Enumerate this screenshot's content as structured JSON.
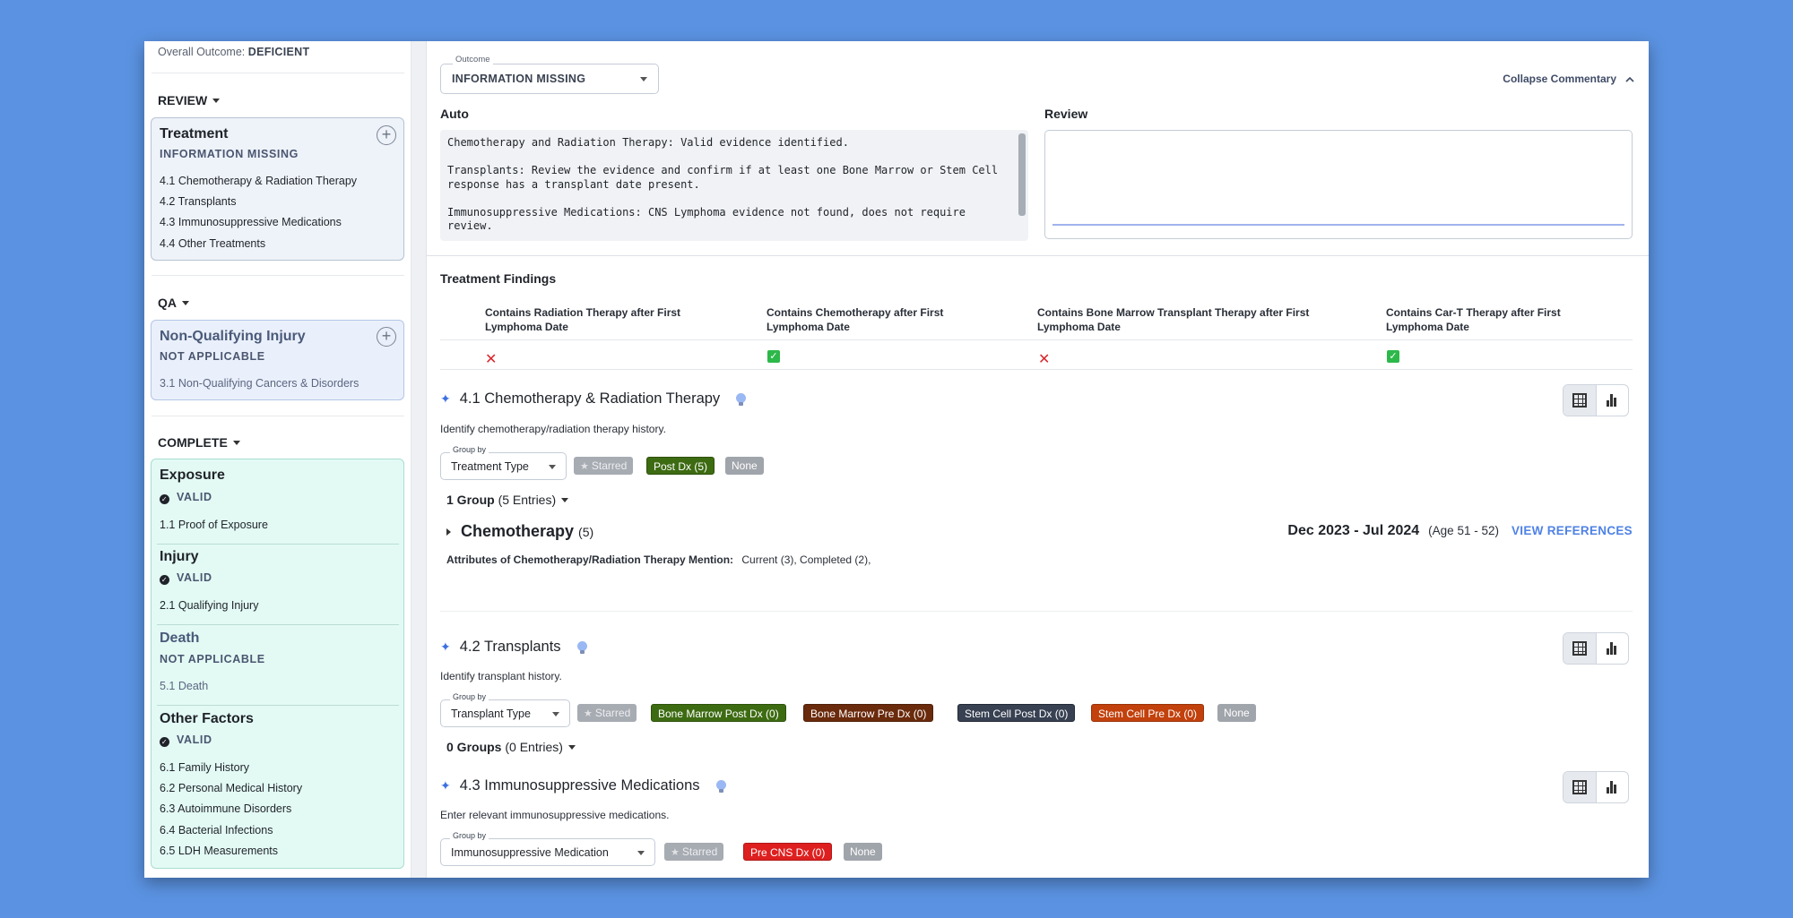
{
  "sidebar": {
    "overall_label": "Overall Outcome:",
    "overall_value": "DEFICIENT",
    "review_head": "REVIEW",
    "qa_head": "QA",
    "complete_head": "COMPLETE",
    "treatment": {
      "title": "Treatment",
      "status": "INFORMATION MISSING",
      "items": [
        "4.1 Chemotherapy & Radiation Therapy",
        "4.2 Transplants",
        "4.3 Immunosuppressive Medications",
        "4.4 Other Treatments"
      ]
    },
    "nonqual": {
      "title": "Non-Qualifying Injury",
      "status": "NOT APPLICABLE",
      "items": [
        "3.1 Non-Qualifying Cancers & Disorders"
      ]
    },
    "exposure": {
      "title": "Exposure",
      "status": "VALID",
      "items": [
        "1.1 Proof of Exposure"
      ]
    },
    "injury": {
      "title": "Injury",
      "status": "VALID",
      "items": [
        "2.1 Qualifying Injury"
      ]
    },
    "death": {
      "title": "Death",
      "status": "NOT APPLICABLE",
      "items": [
        "5.1 Death"
      ]
    },
    "other": {
      "title": "Other Factors",
      "status": "VALID",
      "items": [
        "6.1 Family History",
        "6.2 Personal Medical History",
        "6.3 Autoimmune Disorders",
        "6.4 Bacterial Infections",
        "6.5 LDH Measurements"
      ]
    }
  },
  "main": {
    "outcome_legend": "Outcome",
    "outcome_value": "INFORMATION MISSING",
    "collapse_label": "Collapse Commentary",
    "auto_label": "Auto",
    "review_label": "Review",
    "auto_text": "Chemotherapy and Radiation Therapy: Valid evidence identified.\n\nTransplants: Review the evidence and confirm if at least one Bone Marrow or Stem Cell response has a transplant date present.\n\nImmunosuppressive Medications: CNS Lymphoma evidence not found, does not require review.",
    "findings_title": "Treatment Findings",
    "findings": [
      {
        "header": "Contains Radiation Therapy after First Lymphoma Date",
        "value": "no"
      },
      {
        "header": "Contains Chemotherapy after First Lymphoma Date",
        "value": "yes"
      },
      {
        "header": "Contains Bone Marrow Transplant Therapy after First Lymphoma Date",
        "value": "no"
      },
      {
        "header": "Contains Car-T Therapy after First Lymphoma Date",
        "value": "yes"
      }
    ],
    "marks": {
      "no": "✕",
      "yes": "✓"
    },
    "s41": {
      "title": "4.1 Chemotherapy & Radiation Therapy",
      "desc": "Identify chemotherapy/radiation therapy history.",
      "group_legend": "Group by",
      "group_value": "Treatment Type",
      "chips": [
        "Starred",
        "Post Dx (5)",
        "None"
      ],
      "group_count_bold": "1 Group",
      "group_count_rest": "(5 Entries)",
      "chemo_name": "Chemotherapy",
      "chemo_count": "(5)",
      "date_range": "Dec 2023 - Jul 2024",
      "age": "(Age 51 - 52)",
      "view_refs": "VIEW REFERENCES",
      "attr_label": "Attributes of Chemotherapy/Radiation Therapy Mention:",
      "attr_values": "Current (3),   Completed (2),"
    },
    "s42": {
      "title": "4.2 Transplants",
      "desc": "Identify transplant history.",
      "group_legend": "Group by",
      "group_value": "Transplant Type",
      "chips": [
        "Starred",
        "Bone Marrow Post Dx (0)",
        "Bone Marrow Pre Dx (0)",
        "Stem Cell Post Dx (0)",
        "Stem Cell Pre Dx (0)",
        "None"
      ],
      "group_count_bold": "0 Groups",
      "group_count_rest": "(0 Entries)"
    },
    "s43": {
      "title": "4.3 Immunosuppressive Medications",
      "desc": "Enter relevant immunosuppressive medications.",
      "group_legend": "Group by",
      "group_value": "Immunosuppressive Medication",
      "chips": [
        "Starred",
        "Pre CNS Dx (0)",
        "None"
      ]
    }
  },
  "colors": {
    "page_bg": "#5b93e2",
    "chip_green": "#3d6b12",
    "chip_brown": "#6a2a0c",
    "chip_slate": "#374152",
    "chip_orange": "#c2410c",
    "chip_red": "#de1f1f",
    "link_blue": "#4f82e6"
  }
}
